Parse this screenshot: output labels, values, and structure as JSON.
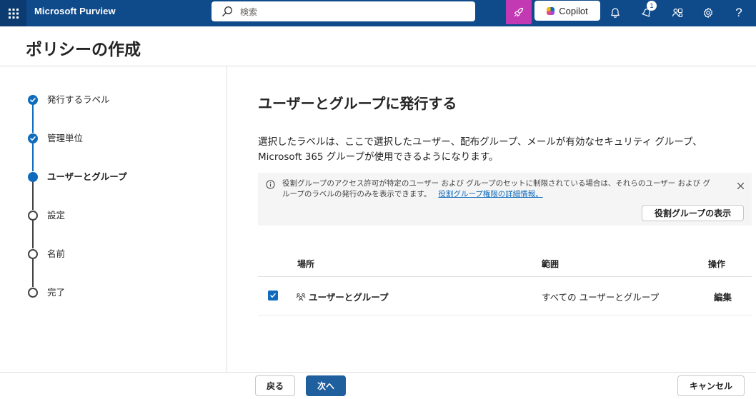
{
  "header": {
    "app_name": "Microsoft Purview",
    "search_placeholder": "検索",
    "copilot_label": "Copilot",
    "notification_count": "1",
    "help_label": "?",
    "icons": [
      "app-launcher-icon",
      "search-icon",
      "rocket-icon",
      "bell-icon",
      "notification-bell-icon",
      "people-icon",
      "gear-icon",
      "help-icon"
    ]
  },
  "page": {
    "title": "ポリシーの作成"
  },
  "steps": [
    {
      "label": "発行するラベル",
      "state": "done"
    },
    {
      "label": "管理単位",
      "state": "done"
    },
    {
      "label": "ユーザーとグループ",
      "state": "current"
    },
    {
      "label": "設定",
      "state": "todo"
    },
    {
      "label": "名前",
      "state": "todo"
    },
    {
      "label": "完了",
      "state": "todo"
    }
  ],
  "main": {
    "heading": "ユーザーとグループに発行する",
    "description_line1": "選択したラベルは、ここで選択したユーザー、配布グループ、メールが有効なセキュリティ グループ、",
    "description_line2": "Microsoft 365 グループが使用できるようになります。",
    "info": {
      "text_line1": "役割グループのアクセス許可が特定のユーザー および グループのセットに制限されている場合は、それらのユーザー および グ",
      "text_line2": "ループのラベルの発行のみを表示できます。",
      "link": "役割グループ権限の詳細情報。",
      "button": "役割グループの表示"
    },
    "table": {
      "headers": {
        "location": "場所",
        "scope": "範囲",
        "action": "操作"
      },
      "rows": [
        {
          "checked": true,
          "location": "ユーザーとグループ",
          "scope": "すべての ユーザーとグループ",
          "action": "編集"
        }
      ]
    }
  },
  "footer": {
    "back": "戻る",
    "next": "次へ",
    "cancel": "キャンセル"
  },
  "colors": {
    "topbar": "#0f4a8a",
    "accent": "#0f6cbd",
    "primary_button": "#1f5f9e",
    "rocket_button": "#c239b3"
  }
}
